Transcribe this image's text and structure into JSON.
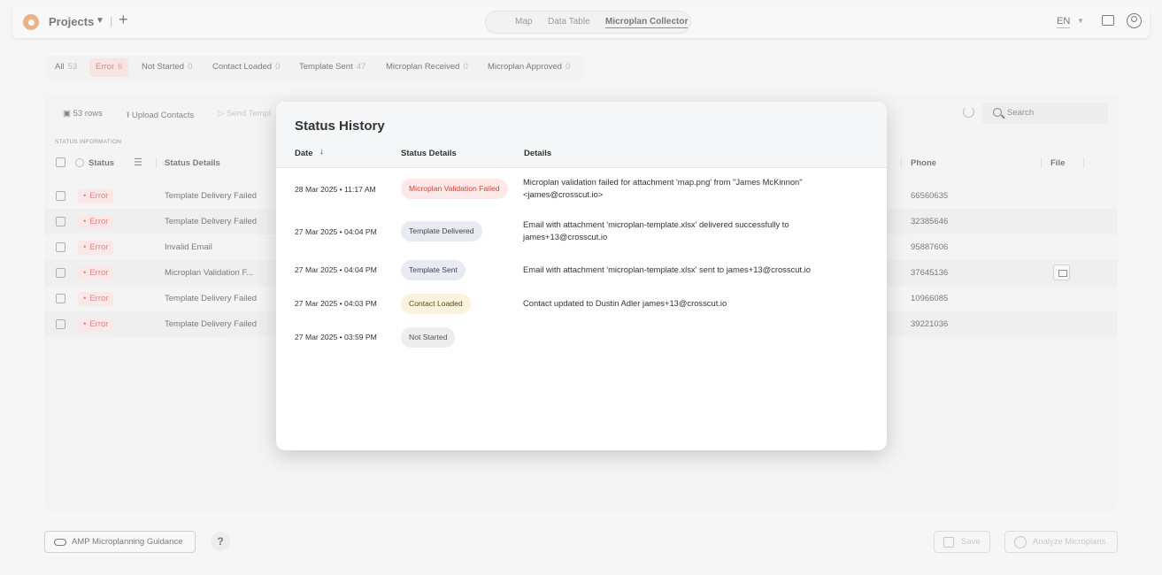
{
  "colors": {
    "error_text": "#d0453b",
    "error_bg": "#f4dcda",
    "pill_failed_bg": "#fce9e7",
    "pill_failed_text": "#d0453b",
    "pill_delivered_bg": "#e8ebf2",
    "pill_sent_bg": "#e8ebf2",
    "pill_loaded_bg": "#faf3dd",
    "pill_notstarted_bg": "#ededed"
  },
  "topbar": {
    "projects_label": "Projects",
    "nav": [
      "Map",
      "Data Table",
      "Microplan Collector"
    ],
    "active_nav": "Microplan Collector",
    "language": "EN"
  },
  "filters": [
    {
      "label": "All",
      "count": "53"
    },
    {
      "label": "Error",
      "count": "6"
    },
    {
      "label": "Not Started",
      "count": "0"
    },
    {
      "label": "Contact Loaded",
      "count": "0"
    },
    {
      "label": "Template Sent",
      "count": "47"
    },
    {
      "label": "Microplan Received",
      "count": "0"
    },
    {
      "label": "Microplan Approved",
      "count": "0"
    }
  ],
  "toolbar": {
    "rows_label": "53 rows",
    "upload_label": "Upload Contacts",
    "send_label": "Send Templ",
    "search_placeholder": "Search"
  },
  "table": {
    "section_label": "STATUS INFORMATION",
    "columns": {
      "status": "Status",
      "status_details": "Status Details",
      "phone": "Phone",
      "file": "File"
    },
    "rows": [
      {
        "status": "Error",
        "details": "Template Delivery Failed",
        "phone": "66560635",
        "has_file": false
      },
      {
        "status": "Error",
        "details": "Template Delivery Failed",
        "phone": "32385646",
        "has_file": false
      },
      {
        "status": "Error",
        "details": "Invalid Email",
        "phone": "95887606",
        "has_file": false
      },
      {
        "status": "Error",
        "details": "Microplan Validation F...",
        "phone": "37645136",
        "has_file": true
      },
      {
        "status": "Error",
        "details": "Template Delivery Failed",
        "phone": "10966085",
        "has_file": false
      },
      {
        "status": "Error",
        "details": "Template Delivery Failed",
        "phone": "39221036",
        "has_file": false
      }
    ]
  },
  "footer": {
    "guidance_label": "AMP Microplanning Guidance",
    "help_label": "?",
    "save_label": "Save",
    "analyze_label": "Analyze Microplans"
  },
  "modal": {
    "title": "Status History",
    "columns": {
      "date": "Date",
      "status_details": "Status Details",
      "details": "Details"
    },
    "rows": [
      {
        "date": "28 Mar 2025 • 11:17 AM",
        "status": "Microplan Validation Failed",
        "kind": "failed",
        "details": "Microplan validation failed for attachment 'map.png' from \"James McKinnon\" <james@crosscut.io>"
      },
      {
        "date": "27 Mar 2025 • 04:04 PM",
        "status": "Template Delivered",
        "kind": "delivered",
        "details": "Email with attachment 'microplan-template.xlsx' delivered successfully to james+13@crosscut.io"
      },
      {
        "date": "27 Mar 2025 • 04:04 PM",
        "status": "Template Sent",
        "kind": "sent",
        "details": "Email with attachment 'microplan-template.xlsx' sent to james+13@crosscut.io"
      },
      {
        "date": "27 Mar 2025 • 04:03 PM",
        "status": "Contact Loaded",
        "kind": "loaded",
        "details": "Contact updated to Dustin Adler james+13@crosscut.io"
      },
      {
        "date": "27 Mar 2025 • 03:59 PM",
        "status": "Not Started",
        "kind": "notstarted",
        "details": ""
      }
    ]
  }
}
